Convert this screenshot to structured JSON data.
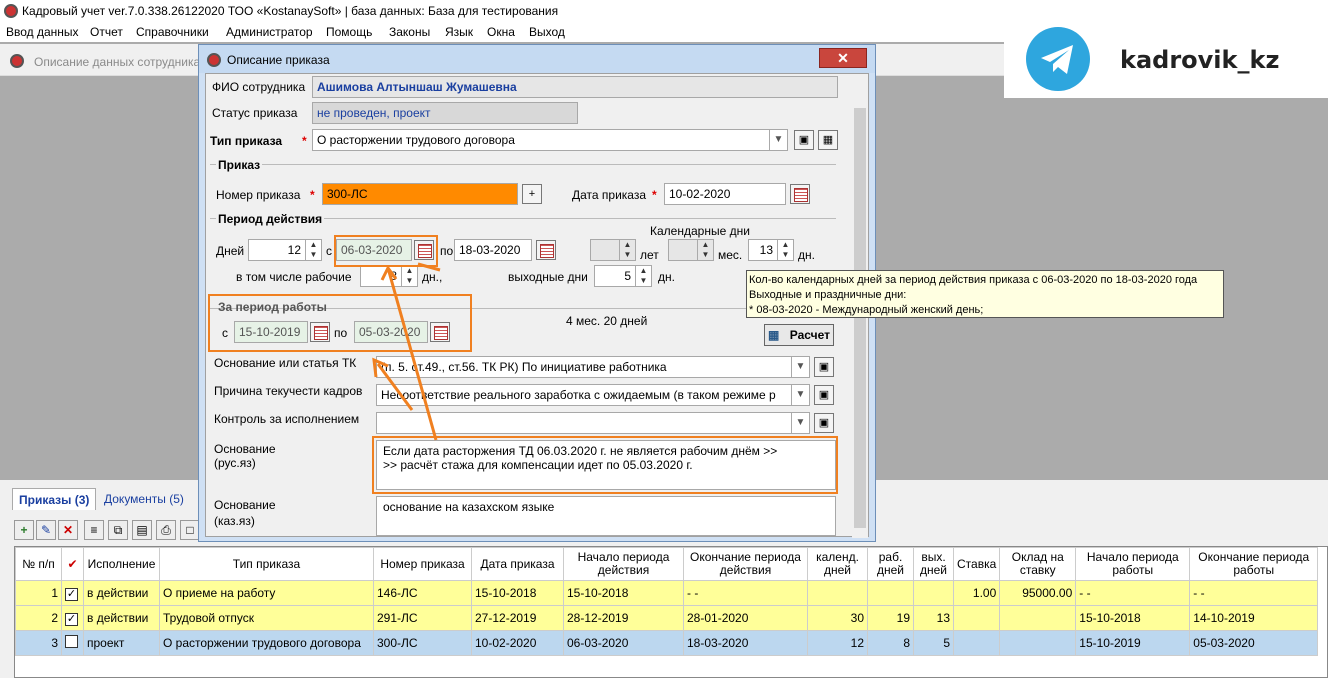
{
  "app": {
    "title": "Кадровый учет ver.7.0.338.26122020 ТОО «KostanaySoft» | база данных: База для тестирования",
    "menu": [
      "Ввод данных",
      "Отчет",
      "Справочники",
      "Администратор",
      "Помощь",
      "Законы",
      "Язык",
      "Окна",
      "Выход"
    ]
  },
  "child": {
    "title": "Описание данных сотрудника"
  },
  "watermark": {
    "text": "kadrovik_kz"
  },
  "dialog": {
    "title": "Описание приказа",
    "fio_label": "ФИО сотрудника",
    "fio_value": "Ашимова Алтыншаш Жумашевна",
    "status_label": "Статус приказа",
    "status_value": "не проведен, проект",
    "type_label": "Тип приказа",
    "type_value": "О расторжении трудового договора",
    "order_section": "Приказ",
    "number_label": "Номер приказа",
    "number_value": "300-ЛС",
    "date_label": "Дата приказа",
    "date_value": "10-02-2020",
    "period_section": "Период действия",
    "cal_days_label": "Календарные дни",
    "days_label": "Дней",
    "days_value": "12",
    "from_label": "с",
    "from_value": "06-03-2020",
    "to_label": "по",
    "to_value": "18-03-2020",
    "years_label": "лет",
    "months_label": "мес.",
    "cal_days_value": "13",
    "days_suffix": "дн.",
    "work_label": "в том числе рабочие",
    "work_value": "8",
    "work_suffix": "дн.,",
    "weekend_label": "выходные дни",
    "weekend_value": "5",
    "weekend_suffix": "дн.",
    "work_period_section": "За период работы",
    "wp_from_label": "с",
    "wp_from_value": "15-10-2019",
    "wp_to_label": "по",
    "wp_to_value": "05-03-2020",
    "duration": "4 мес. 20 дней",
    "calc_button": "Расчет",
    "basis_label": "Основание или статья ТК",
    "basis_value": "(п. 5. ст.49., ст.56. ТК РК) По инициативе работника",
    "reason_label": "Причина текучести кадров",
    "reason_value": "Несоответствие реального заработка с ожидаемым (в таком режиме р",
    "control_label": "Контроль за исполнением",
    "control_value": "",
    "osn_rus_label1": "Основание",
    "osn_rus_label2": "(рус.яз)",
    "osn_rus_line1": "Если дата расторжения ТД 06.03.2020 г. не является рабочим днём >>",
    "osn_rus_line2": ">> расчёт стажа для компенсации идет по 05.03.2020 г.",
    "osn_kaz_label1": "Основание",
    "osn_kaz_label2": "(каз.яз)",
    "osn_kaz_value": "основание на казахском языке"
  },
  "tooltip": {
    "line1": "Кол-во календарных дней за период действия приказа с 06-03-2020 по 18-03-2020 года",
    "line2": "Выходные и праздничные дни:",
    "line3": "* 08-03-2020 - Международный женский день;"
  },
  "tabs": [
    "Приказы (3)",
    "Документы (5)"
  ],
  "table": {
    "headers": [
      "№ п/п",
      "",
      "Исполнение",
      "Тип приказа",
      "Номер приказа",
      "Дата приказа",
      "Начало периода действия",
      "Окончание периода действия",
      "календ. дней",
      "раб. дней",
      "вых. дней",
      "Ставка",
      "Оклад на ставку",
      "Начало периода работы",
      "Окончание периода работы"
    ],
    "rows": [
      [
        "1",
        "✓",
        "в действии",
        "О приеме на работу",
        "146-ЛС",
        "15-10-2018",
        "15-10-2018",
        "- -",
        "",
        "",
        "",
        "1.00",
        "95000.00",
        "- -",
        "- -"
      ],
      [
        "2",
        "✓",
        "в действии",
        "Трудовой отпуск",
        "291-ЛС",
        "27-12-2019",
        "28-12-2019",
        "28-01-2020",
        "30",
        "19",
        "13",
        "",
        "",
        "15-10-2018",
        "14-10-2019"
      ],
      [
        "3",
        "",
        "проект",
        "О расторжении трудового договора",
        "300-ЛС",
        "10-02-2020",
        "06-03-2020",
        "18-03-2020",
        "12",
        "8",
        "5",
        "",
        "",
        "15-10-2019",
        "05-03-2020"
      ]
    ]
  }
}
